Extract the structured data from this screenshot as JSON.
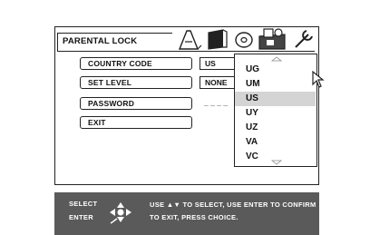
{
  "title": "PARENTAL LOCK",
  "menu": {
    "country_code": {
      "label": "COUNTRY CODE",
      "value": "US"
    },
    "set_level": {
      "label": "SET LEVEL",
      "value": "NONE"
    },
    "password": {
      "label": "PASSWORD",
      "value": "_ _ _ _"
    },
    "exit": {
      "label": "EXIT"
    }
  },
  "dropdown": {
    "items": [
      "UG",
      "UM",
      "US",
      "UY",
      "UZ",
      "VA",
      "VC"
    ],
    "selected": "US"
  },
  "footer": {
    "select_label": "SELECT",
    "enter_label": "ENTER",
    "line1": "USE ▲▼ TO SELECT, USE ENTER TO CONFIRM",
    "line2": "TO EXIT, PRESS CHOICE."
  },
  "colors": {
    "footer_bg": "#5a5a5a",
    "selected_bg": "#d4d4d4"
  },
  "icons": [
    "audio-icon",
    "display-icon",
    "disc-icon",
    "parental-lock-icon",
    "setup-wrench-icon"
  ]
}
